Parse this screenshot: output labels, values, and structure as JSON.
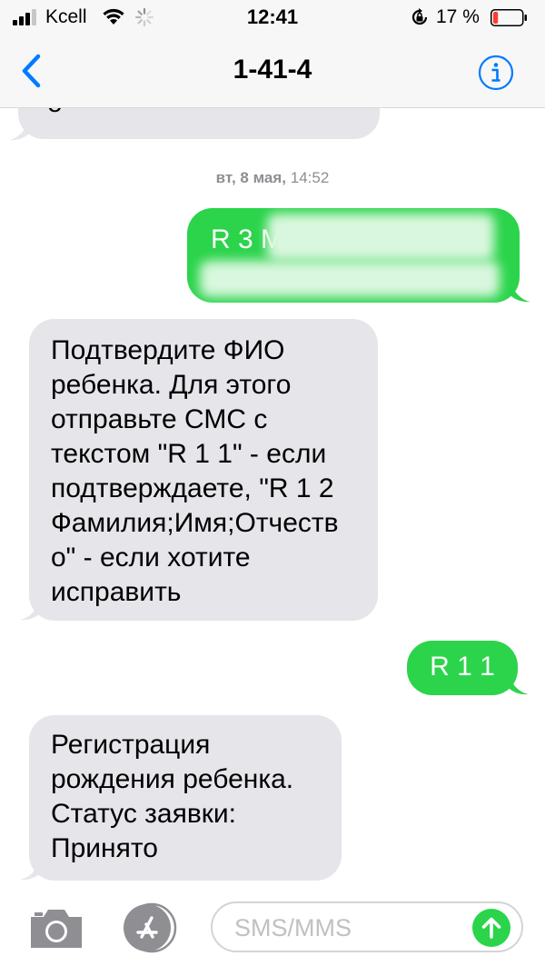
{
  "status_bar": {
    "carrier": "Kcell",
    "time": "12:41",
    "battery_percent": "17 %",
    "battery_level": 0.17,
    "battery_color": "#ff3b30"
  },
  "nav": {
    "title": "1-41-4",
    "back_icon": "chevron-left-icon",
    "info_icon": "info-icon"
  },
  "conversation": {
    "timestamp_day": "вт, 8 мая,",
    "timestamp_time": "14:52",
    "messages": [
      {
        "direction": "incoming",
        "lines": [
          "о"
        ]
      },
      {
        "direction": "outgoing",
        "lines": [
          "R 3 M"
        ],
        "redacted": true
      },
      {
        "direction": "incoming",
        "lines": [
          "Подтвердите ФИО",
          "ребенка. Для этого",
          "отправьте СМС с",
          "текстом \"R 1 1\" - если",
          "подтверждаете, \"R 1 2",
          "Фамилия;Имя;Отчеств",
          "о\" - если хотите",
          "исправить"
        ]
      },
      {
        "direction": "outgoing",
        "lines": [
          "R 1 1"
        ]
      },
      {
        "direction": "incoming",
        "lines": [
          "Регистрация",
          "рождения ребенка.",
          "Статус заявки:",
          "Принято"
        ]
      }
    ]
  },
  "input_bar": {
    "placeholder": "SMS/MMS",
    "value": "",
    "camera_icon": "camera-icon",
    "apps_icon": "app-store-icon",
    "send_icon": "send-arrow-icon"
  },
  "colors": {
    "incoming_bubble": "#e5e5ea",
    "outgoing_bubble": "#2bd44b",
    "accent": "#007aff",
    "send_button": "#2bd44b"
  }
}
